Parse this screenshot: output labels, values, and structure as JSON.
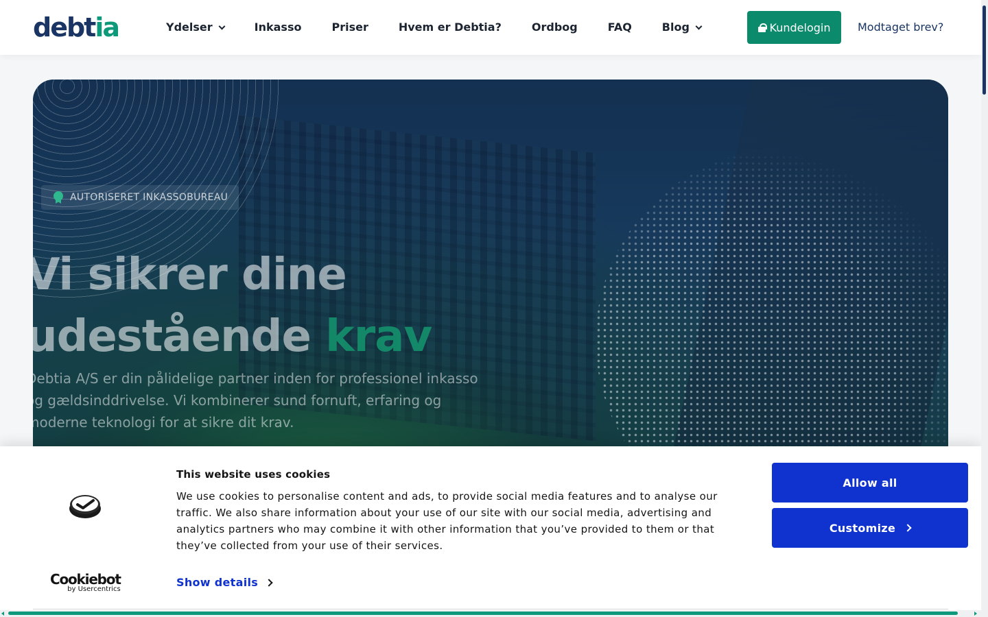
{
  "header": {
    "logo_main": "debt",
    "logo_accent": "ia",
    "nav": [
      {
        "label": "Ydelser",
        "has_dropdown": true
      },
      {
        "label": "Inkasso",
        "has_dropdown": false
      },
      {
        "label": "Priser",
        "has_dropdown": false
      },
      {
        "label": "Hvem er Debtia?",
        "has_dropdown": false
      },
      {
        "label": "Ordbog",
        "has_dropdown": false
      },
      {
        "label": "FAQ",
        "has_dropdown": false
      },
      {
        "label": "Blog",
        "has_dropdown": true
      }
    ],
    "login_label": "Kundelogin",
    "received_label": "Modtaget brev?"
  },
  "hero": {
    "badge": "AUTORISERET INKASSOBUREAU",
    "title_line1": "Vi sikrer dine",
    "title_line2_a": "udestående ",
    "title_line2_b": "krav",
    "subtitle": "Debtia A/S er din pålidelige partner inden for professionel inkasso og gældsinddrivelse. Vi kombinerer sund fornuft, erfaring og moderne teknologi for at sikre dit krav."
  },
  "cookie_banner": {
    "title": "This website uses cookies",
    "text": "We use cookies to personalise content and ads, to provide social media features and to analyse our traffic. We also share information about your use of our site with our social media, advertising and analytics partners who may combine it with other information that you’ve provided to them or that they’ve collected from your use of their services.",
    "show_details": "Show details",
    "allow_all": "Allow all",
    "customize": "Customize",
    "brand_name": "Cookiebot",
    "brand_by": "by Usercentrics"
  },
  "colors": {
    "brand_navy": "#1a3563",
    "brand_green": "#0b8a6c",
    "cookie_blue": "#1032cf"
  }
}
